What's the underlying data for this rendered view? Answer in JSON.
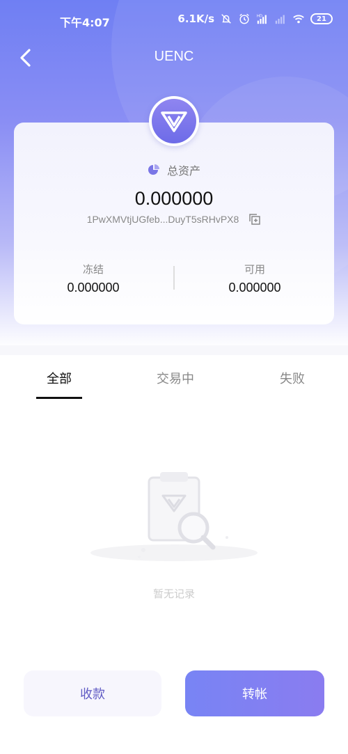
{
  "status_bar": {
    "time": "下午4:07",
    "network_speed": "6.1K/s",
    "battery_level": "21",
    "icons": [
      "alarm-off-icon",
      "alarm-icon",
      "signal-hd-icon",
      "signal-icon",
      "wifi-icon",
      "battery-icon"
    ]
  },
  "header": {
    "title": "UENC",
    "back_icon": "chevron-left-icon"
  },
  "asset_card": {
    "total_label": "总资产",
    "total_value": "0.000000",
    "address": "1PwXMVtjUGfeb...DuyT5sRHvPX8",
    "frozen_label": "冻结",
    "frozen_value": "0.000000",
    "available_label": "可用",
    "available_value": "0.000000"
  },
  "tabs": {
    "all": "全部",
    "trading": "交易中",
    "failed": "失败",
    "active": "all"
  },
  "empty_state": {
    "text": "暂无记录"
  },
  "actions": {
    "receive": "收款",
    "transfer": "转帐"
  },
  "colors": {
    "brand": "#7b7ef2",
    "accent_text": "#5f5ac4"
  }
}
